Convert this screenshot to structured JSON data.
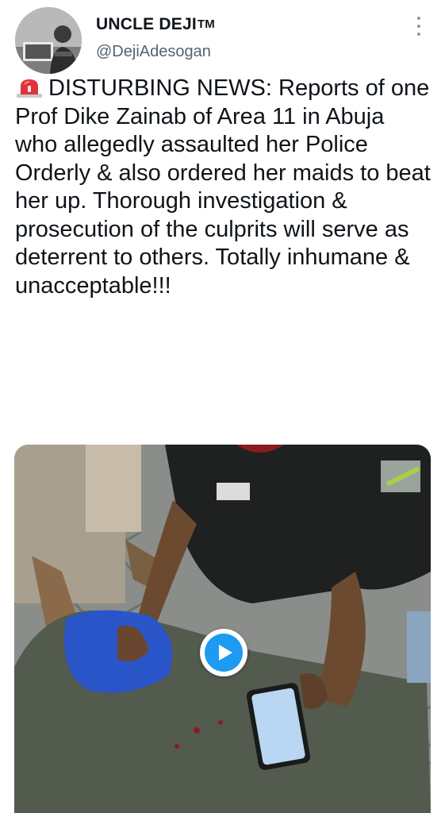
{
  "author": {
    "display_name": "UNCLE DEJI",
    "trademark": "TM",
    "handle": "@DejiAdesogan",
    "avatar": "avatar-photo"
  },
  "icons": {
    "more": "more-options-icon",
    "siren": "siren-icon",
    "play": "play-icon"
  },
  "tweet": {
    "text": "DISTURBING NEWS: Reports of one Prof Dike Zainab of Area 11 in Abuja who allegedly assaulted her Police Orderly & also ordered her maids to beat her up. Thorough investigation & prosecution of the culprits will serve as deterrent to others. Totally inhumane & unacceptable!!!"
  },
  "media": {
    "type": "video",
    "accent_color": "#1d9bf0"
  }
}
